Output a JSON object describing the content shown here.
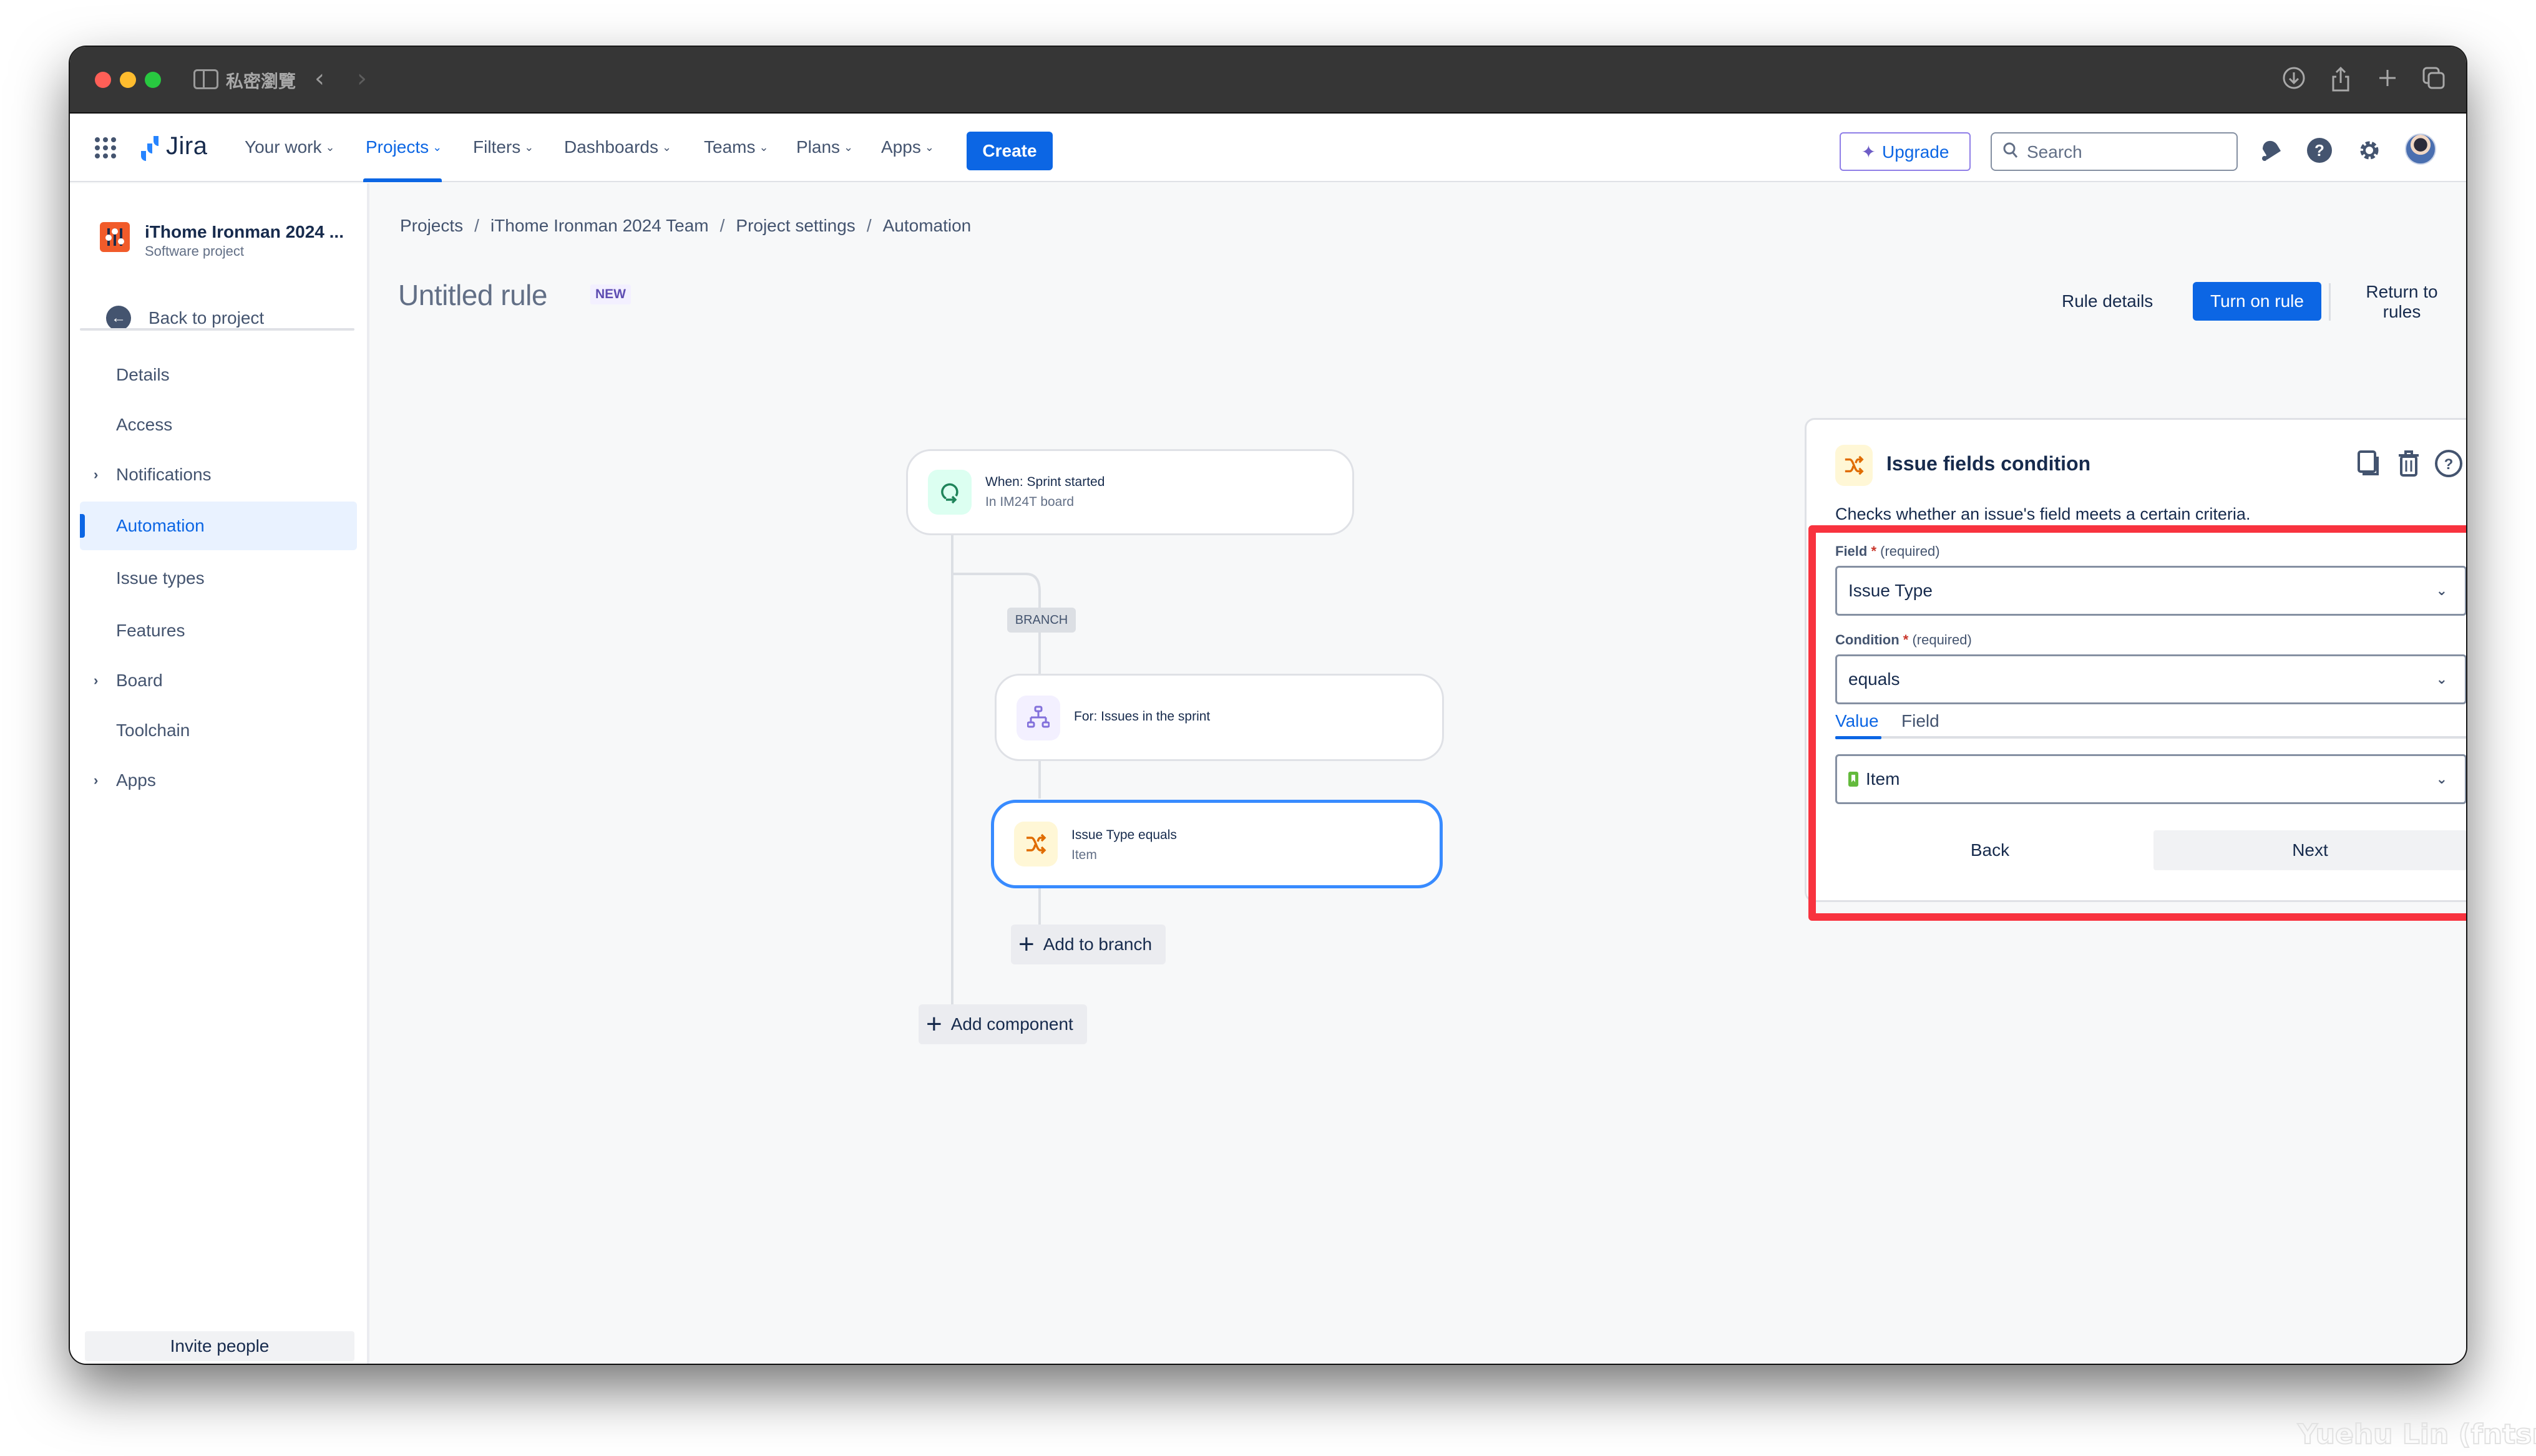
{
  "browser": {
    "title": "私密瀏覽",
    "back_glyph": "‹",
    "forward_glyph": "›",
    "toolbar_icons": [
      "download-icon",
      "share-icon",
      "new-tab-icon",
      "tab-overview-icon"
    ]
  },
  "topnav": {
    "product": "Jira",
    "items": [
      {
        "label": "Your work",
        "active": false
      },
      {
        "label": "Projects",
        "active": true
      },
      {
        "label": "Filters",
        "active": false
      },
      {
        "label": "Dashboards",
        "active": false
      },
      {
        "label": "Teams",
        "active": false
      },
      {
        "label": "Plans",
        "active": false
      },
      {
        "label": "Apps",
        "active": false
      }
    ],
    "create_label": "Create",
    "upgrade_label": "Upgrade",
    "search_placeholder": "Search"
  },
  "sidebar": {
    "project_name": "iThome Ironman 2024 ...",
    "project_type": "Software project",
    "back_label": "Back to project",
    "items": [
      {
        "label": "Details",
        "expandable": false,
        "active": false
      },
      {
        "label": "Access",
        "expandable": false,
        "active": false
      },
      {
        "label": "Notifications",
        "expandable": true,
        "active": false
      },
      {
        "label": "Automation",
        "expandable": false,
        "active": true
      },
      {
        "label": "Issue types",
        "expandable": false,
        "active": false
      },
      {
        "label": "Features",
        "expandable": false,
        "active": false
      },
      {
        "label": "Board",
        "expandable": true,
        "active": false
      },
      {
        "label": "Toolchain",
        "expandable": false,
        "active": false
      },
      {
        "label": "Apps",
        "expandable": true,
        "active": false
      }
    ],
    "invite_label": "Invite people"
  },
  "breadcrumb": [
    "Projects",
    "iThome Ironman 2024 Team",
    "Project settings",
    "Automation"
  ],
  "rule": {
    "title": "Untitled rule",
    "badge": "NEW",
    "rule_details_label": "Rule details",
    "turn_on_label": "Turn on rule",
    "return_label": "Return to rules"
  },
  "flow": {
    "trigger": {
      "title": "When: Sprint started",
      "subtitle": "In IM24T board"
    },
    "branch_label": "BRANCH",
    "branch_node": {
      "title": "For: Issues in the sprint"
    },
    "condition_node": {
      "title": "Issue Type equals",
      "subtitle": "Item"
    },
    "add_to_branch_label": "Add to branch",
    "add_component_label": "Add component"
  },
  "panel": {
    "title": "Issue fields condition",
    "description": "Checks whether an issue's field meets a certain criteria.",
    "field_label": "Field",
    "field_required_text": "(required)",
    "field_value": "Issue Type",
    "condition_label": "Condition",
    "condition_required_text": "(required)",
    "condition_value": "equals",
    "tabs": [
      {
        "label": "Value",
        "active": true
      },
      {
        "label": "Field",
        "active": false
      }
    ],
    "value_selected": "Item",
    "back_label": "Back",
    "next_label": "Next"
  },
  "colors": {
    "accent": "#0c66e4",
    "highlight_box": "#f8333f",
    "trigger_icon_bg": "#dcfff1",
    "branch_icon_bg": "#f3f0ff",
    "condition_icon_bg": "#fff7d6"
  },
  "watermark": "Yuehu Lin (fntsr.tw)"
}
